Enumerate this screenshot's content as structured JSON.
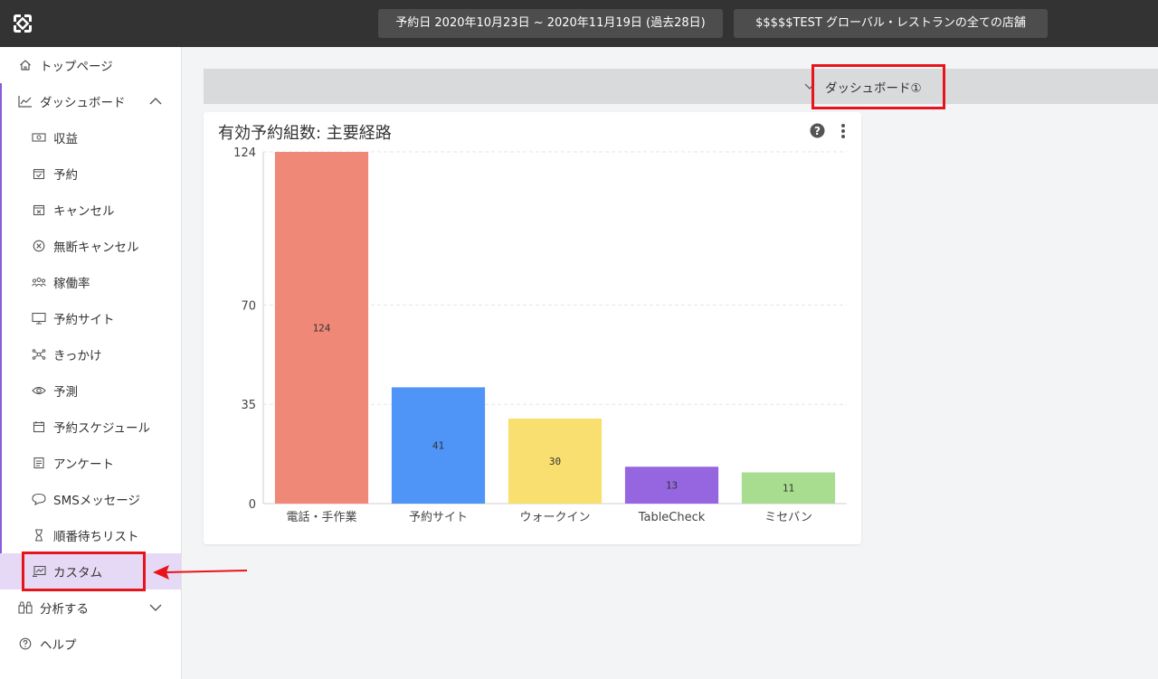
{
  "header": {
    "date_range": "予約日 2020年10月23日 ~ 2020年11月19日 (過去28日)",
    "store_selector": "$$$$$TEST グローバル・レストランの全ての店舗"
  },
  "sidebar": {
    "items": [
      {
        "label": "トップページ",
        "icon": "home-icon"
      },
      {
        "label": "ダッシュボード",
        "icon": "chart-line-icon"
      },
      {
        "label": "収益",
        "icon": "money-icon"
      },
      {
        "label": "予約",
        "icon": "calendar-check-icon"
      },
      {
        "label": "キャンセル",
        "icon": "calendar-x-icon"
      },
      {
        "label": "無断キャンセル",
        "icon": "circle-x-icon"
      },
      {
        "label": "稼働率",
        "icon": "people-icon"
      },
      {
        "label": "予約サイト",
        "icon": "monitor-icon"
      },
      {
        "label": "きっかけ",
        "icon": "network-icon"
      },
      {
        "label": "予測",
        "icon": "eye-icon"
      },
      {
        "label": "予約スケジュール",
        "icon": "calendar-icon"
      },
      {
        "label": "アンケート",
        "icon": "document-icon"
      },
      {
        "label": "SMSメッセージ",
        "icon": "chat-bubble-icon"
      },
      {
        "label": "順番待ちリスト",
        "icon": "hourglass-icon"
      },
      {
        "label": "カスタム",
        "icon": "custom-chart-icon"
      },
      {
        "label": "分析する",
        "icon": "binoculars-icon"
      },
      {
        "label": "ヘルプ",
        "icon": "question-circle-icon"
      }
    ],
    "active_item": "カスタム"
  },
  "dashboard": {
    "title": "ダッシュボード①"
  },
  "card": {
    "title": "有効予約組数: 主要経路"
  },
  "colors": {
    "topbar": "#333333",
    "accent": "#8a5cd8",
    "annotation": "#e8141b"
  },
  "chart_data": {
    "type": "bar",
    "title": "有効予約組数: 主要経路",
    "categories": [
      "電話・手作業",
      "予約サイト",
      "ウォークイン",
      "TableCheck",
      "ミセバン"
    ],
    "values": [
      124,
      41,
      30,
      13,
      11
    ],
    "colors": [
      "#ef8877",
      "#4f94f7",
      "#f9df6f",
      "#9566e0",
      "#a8dd8f"
    ],
    "yticks": [
      0,
      35,
      70,
      124
    ],
    "ylim": [
      0,
      124
    ],
    "grid": true,
    "xlabel": "",
    "ylabel": ""
  }
}
